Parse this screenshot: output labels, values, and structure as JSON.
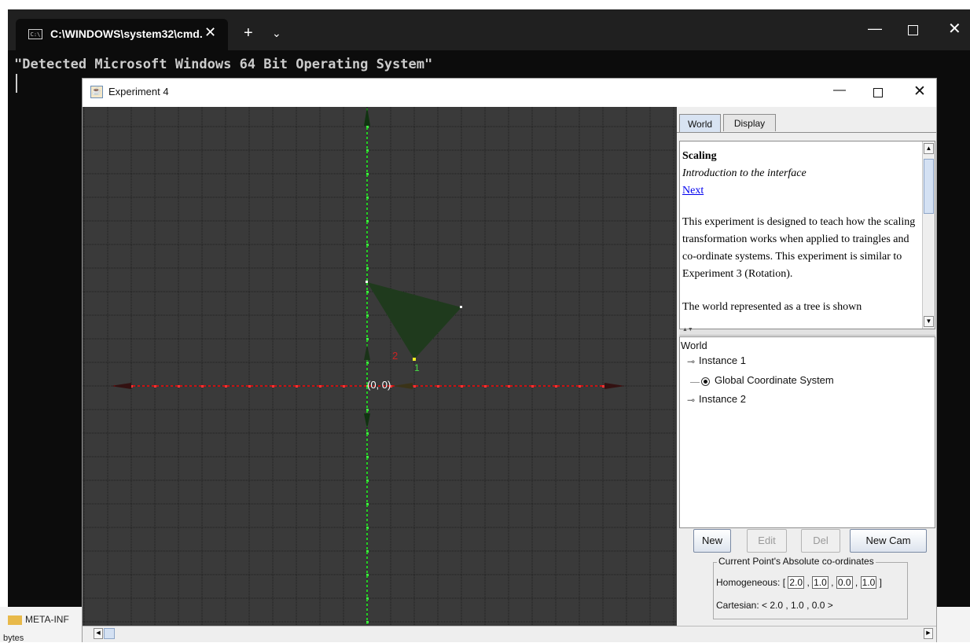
{
  "desktop": {
    "folder_label": "META-INF",
    "bytes_label": "bytes"
  },
  "terminal": {
    "tab_title": "C:\\WINDOWS\\system32\\cmd.",
    "tab_icon_label": "C:\\",
    "close_tab_glyph": "✕",
    "new_tab_glyph": "+",
    "dropdown_glyph": "⌄",
    "minimize_glyph": "—",
    "close_glyph": "✕",
    "output_line": "\"Detected Microsoft Windows 64 Bit Operating System\""
  },
  "app": {
    "title": "Experiment 4",
    "minimize_glyph": "—",
    "close_glyph": "✕",
    "canvas": {
      "origin_label": "(0, 0)",
      "vertex_label_1": "1",
      "vertex_label_2": "2",
      "colors": {
        "background": "#3a3a3a",
        "grid": "#1e1e1e",
        "x_axis": "#cc1111",
        "y_axis": "#22cc22",
        "triangle": "#1f3a1d"
      }
    },
    "tabs": {
      "world": "World",
      "display": "Display"
    },
    "info": {
      "title": "Scaling",
      "subtitle": "Introduction to the interface",
      "link": "Next",
      "para1": "This experiment is designed to teach how the scaling transformation works when applied to traingles and co-ordinate systems. This experiment is similar to Experiment 3 (Rotation).",
      "para2": "The world represented as a tree is shown"
    },
    "tree": {
      "root": "World",
      "instance1": "Instance 1",
      "gcs": "Global Coordinate System",
      "instance2": "Instance 2"
    },
    "buttons": {
      "new": "New",
      "edit": "Edit",
      "del": "Del",
      "new_cam": "New Cam"
    },
    "coords": {
      "legend": "Current Point's Absolute co-ordinates",
      "homog_label": "Homogeneous: [",
      "h1": "2.0",
      "h2": "1.0",
      "h3": "0.0",
      "h4": "1.0",
      "sep": ",",
      "close_bracket": "]",
      "cartesian": "Cartesian: < 2.0 , 1.0 , 0.0 >"
    }
  }
}
